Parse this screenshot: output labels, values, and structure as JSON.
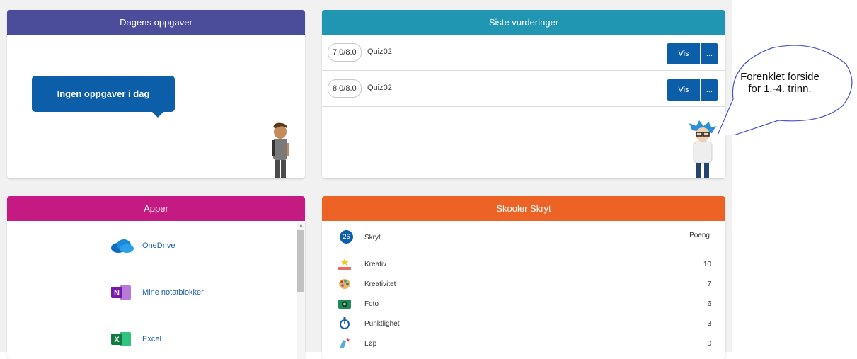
{
  "tasks_card": {
    "title": "Dagens oppgaver",
    "empty_message": "Ingen oppgaver i dag"
  },
  "assessments_card": {
    "title": "Siste vurderinger",
    "rows": [
      {
        "score": "7.0/8.0",
        "name": "Quiz02",
        "view_label": "Vis",
        "more_label": "..."
      },
      {
        "score": "8.0/8.0",
        "name": "Quiz02",
        "view_label": "Vis",
        "more_label": "..."
      }
    ]
  },
  "apps_card": {
    "title": "Apper",
    "items": [
      {
        "label": "OneDrive",
        "icon": "onedrive-icon"
      },
      {
        "label": "Mine notatblokker",
        "icon": "onenote-icon"
      },
      {
        "label": "Excel",
        "icon": "excel-icon"
      }
    ]
  },
  "brag_card": {
    "title": "Skooler Skryt",
    "count": "26",
    "column_label": "Skryt",
    "points_label": "Poeng",
    "rows": [
      {
        "label": "Kreativ",
        "value": "10",
        "icon": "podium-star-icon"
      },
      {
        "label": "Kreativitet",
        "value": "7",
        "icon": "palette-icon"
      },
      {
        "label": "Foto",
        "value": "6",
        "icon": "camera-icon"
      },
      {
        "label": "Punktlighet",
        "value": "3",
        "icon": "stopwatch-icon"
      },
      {
        "label": "Løp",
        "value": "0",
        "icon": "running-shoe-icon"
      }
    ]
  },
  "callout": {
    "line1": "Forenklet forside",
    "line2": "for 1.-4. trinn."
  },
  "colors": {
    "tasks_header": "#4b4d9b",
    "assessments_header": "#2196b3",
    "apps_header": "#c41a82",
    "brag_header": "#ec6325",
    "button": "#0d5ea8"
  }
}
